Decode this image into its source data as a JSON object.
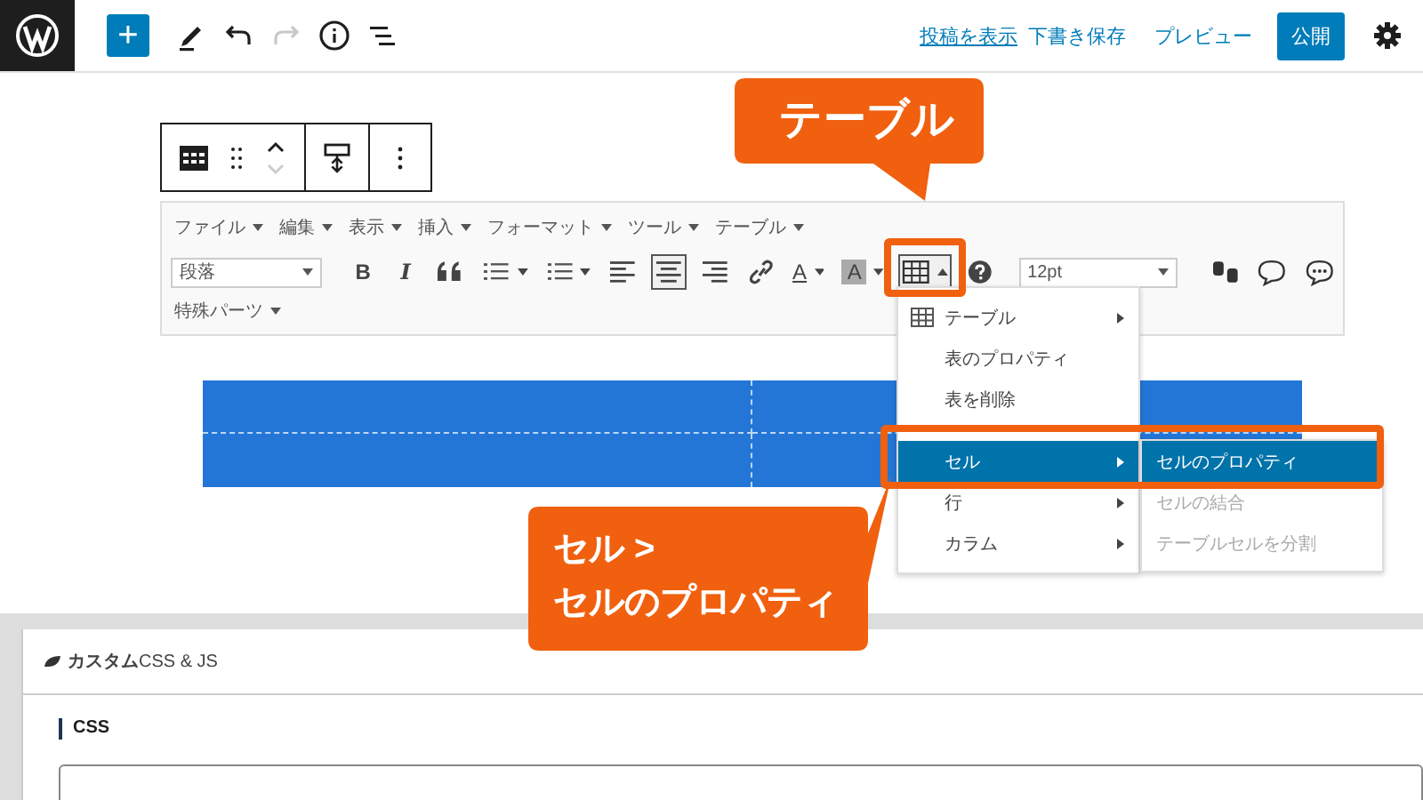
{
  "topbar": {
    "add_label": "+",
    "tools": [
      {
        "kind": "pencil",
        "disabled": false
      },
      {
        "kind": "undo",
        "disabled": false
      },
      {
        "kind": "redo",
        "disabled": true
      },
      {
        "kind": "info",
        "disabled": false
      },
      {
        "kind": "outline",
        "disabled": false
      }
    ],
    "view_post": "投稿を表示",
    "save_draft": "下書き保存",
    "preview": "プレビュー",
    "publish": "公開"
  },
  "editor": {
    "menus": [
      "ファイル",
      "編集",
      "表示",
      "挿入",
      "フォーマット",
      "ツール",
      "テーブル"
    ],
    "format_select": "段落",
    "tools": [
      {
        "kind": "bold",
        "label": "B",
        "active": false,
        "dropdown": false
      },
      {
        "kind": "italic",
        "label": "I",
        "active": false,
        "dropdown": false
      },
      {
        "kind": "quote",
        "active": false,
        "dropdown": false
      },
      {
        "kind": "bullets",
        "active": false,
        "dropdown": true
      },
      {
        "kind": "numbers",
        "active": false,
        "dropdown": true
      },
      {
        "kind": "align-left",
        "active": false,
        "dropdown": false
      },
      {
        "kind": "align-center",
        "active": true,
        "dropdown": false
      },
      {
        "kind": "align-right",
        "active": false,
        "dropdown": false
      },
      {
        "kind": "link",
        "active": false,
        "dropdown": false
      },
      {
        "kind": "text-color",
        "label": "A",
        "active": false,
        "dropdown": true
      },
      {
        "kind": "back-color",
        "label": "A",
        "active": false,
        "dropdown": true
      },
      {
        "kind": "table",
        "active": true,
        "dropdown": true
      },
      {
        "kind": "help",
        "active": false,
        "dropdown": false
      }
    ],
    "font_size": "12pt",
    "extra_tools": [
      {
        "kind": "shortcode"
      },
      {
        "kind": "comment"
      },
      {
        "kind": "chat"
      }
    ],
    "special": "特殊パーツ"
  },
  "table_menu": [
    {
      "kind": "item",
      "label": "テーブル",
      "icon": true,
      "submenu": true,
      "selected": false
    },
    {
      "kind": "item",
      "label": "表のプロパティ",
      "icon": false,
      "submenu": false,
      "selected": false
    },
    {
      "kind": "item",
      "label": "表を削除",
      "icon": false,
      "submenu": false,
      "selected": false
    },
    {
      "kind": "divider"
    },
    {
      "kind": "item",
      "label": "セル",
      "icon": false,
      "submenu": true,
      "selected": true
    },
    {
      "kind": "item",
      "label": "行",
      "icon": false,
      "submenu": true,
      "selected": false
    },
    {
      "kind": "item",
      "label": "カラム",
      "icon": false,
      "submenu": true,
      "selected": false
    }
  ],
  "cell_submenu": [
    {
      "label": "セルのプロパティ",
      "selected": true,
      "disabled": false
    },
    {
      "label": "セルの結合",
      "selected": false,
      "disabled": true
    },
    {
      "label": "テーブルセルを分割",
      "selected": false,
      "disabled": true
    }
  ],
  "callouts": [
    {
      "lines": [
        "テーブル"
      ]
    },
    {
      "lines": [
        "セル >",
        "セルのプロパティ"
      ]
    }
  ],
  "custom_panel": {
    "title": "**カスタム**CSS & JS",
    "section": "CSS"
  }
}
